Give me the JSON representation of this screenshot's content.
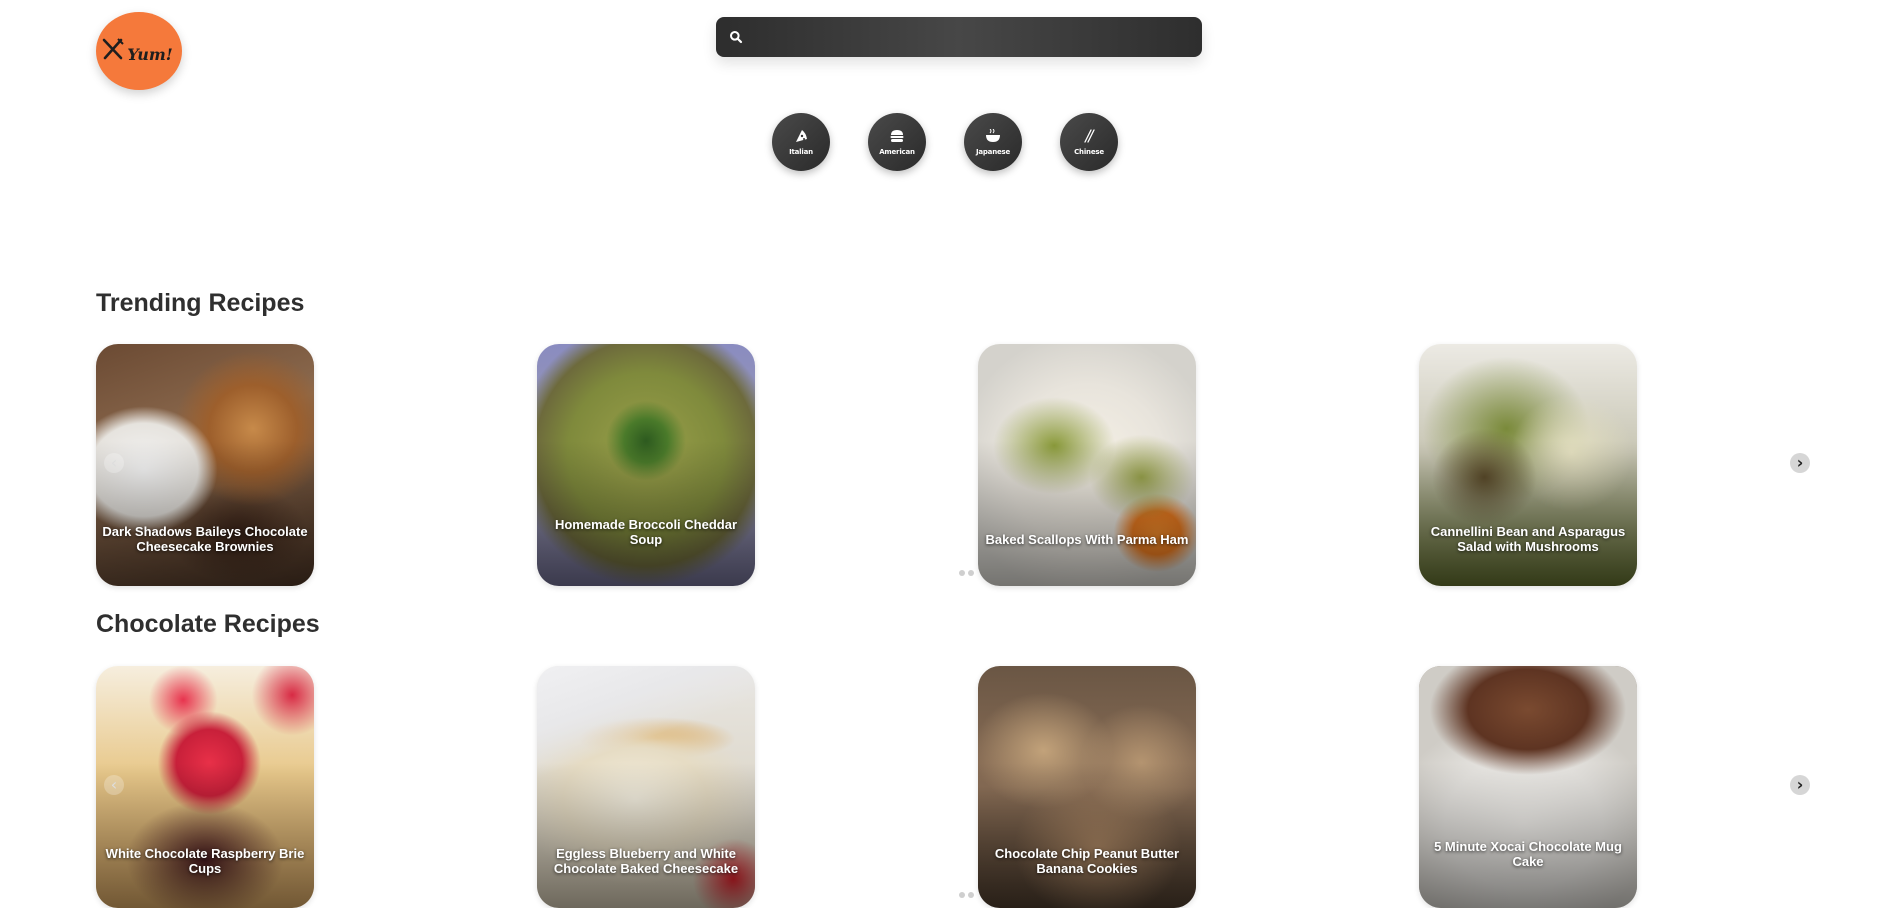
{
  "logo": {
    "text": "Yum!",
    "icon": "fork-knife-icon",
    "color": "#f5793b"
  },
  "search": {
    "placeholder": "",
    "value": "",
    "icon": "search-icon"
  },
  "cuisines": [
    {
      "label": "Italian",
      "icon": "pizza-icon"
    },
    {
      "label": "American",
      "icon": "burger-icon"
    },
    {
      "label": "Japanese",
      "icon": "ramen-bowl-icon"
    },
    {
      "label": "Chinese",
      "icon": "chopsticks-icon"
    }
  ],
  "sections": {
    "trending": {
      "title": "Trending Recipes",
      "cards": [
        {
          "title": "Dark Shadows Baileys Chocolate Cheesecake Brownies"
        },
        {
          "title": "Homemade Broccoli Cheddar Soup"
        },
        {
          "title": "Baked Scallops With Parma Ham"
        },
        {
          "title": "Cannellini Bean and Asparagus Salad with Mushrooms"
        }
      ]
    },
    "chocolate": {
      "title": "Chocolate Recipes",
      "cards": [
        {
          "title": "White Chocolate Raspberry Brie Cups"
        },
        {
          "title": "Eggless Blueberry and White Chocolate Baked Cheesecake"
        },
        {
          "title": "Chocolate Chip Peanut Butter Banana Cookies"
        },
        {
          "title": "5 Minute Xocai Chocolate Mug Cake"
        }
      ]
    }
  },
  "carousel": {
    "prev_symbol": "‹",
    "next_symbol": "›"
  },
  "colors": {
    "accent": "#f5793b",
    "dark": "#2f2f2f"
  }
}
